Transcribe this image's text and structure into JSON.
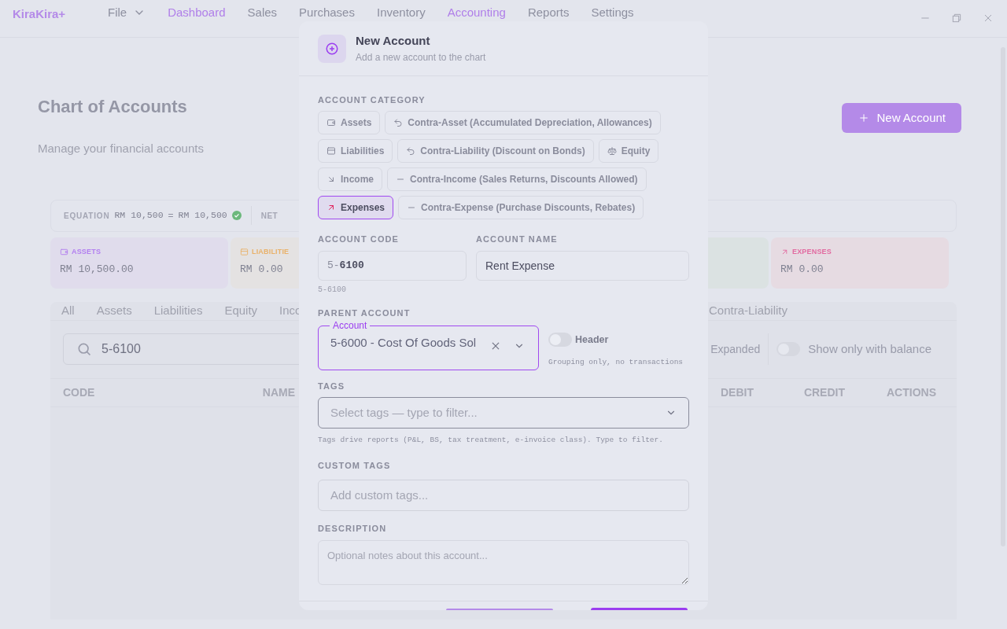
{
  "app": {
    "logo": "KiraKira+"
  },
  "menu": [
    {
      "label": "File",
      "kind": "dropdown",
      "selected": false
    },
    {
      "label": "Dashboard",
      "kind": "link",
      "selected": true
    },
    {
      "label": "Sales",
      "kind": "link",
      "selected": false
    },
    {
      "label": "Purchases",
      "kind": "link",
      "selected": false
    },
    {
      "label": "Inventory",
      "kind": "link",
      "selected": false
    },
    {
      "label": "Accounting",
      "kind": "link",
      "selected": true
    },
    {
      "label": "Reports",
      "kind": "link",
      "selected": false
    },
    {
      "label": "Settings",
      "kind": "link",
      "selected": false
    }
  ],
  "page": {
    "title": "Chart of Accounts",
    "subtitle": "Manage your financial accounts",
    "new_button": "New Account"
  },
  "equation": {
    "label": "EQUATION",
    "left": "RM 10,500",
    "sign": "=",
    "right": "RM 10,500",
    "balanced": true,
    "next_label": "NET"
  },
  "summary_cards": [
    {
      "kind": "assets",
      "label": "ASSETS",
      "amount": "RM 10,500.00"
    },
    {
      "kind": "liabilities",
      "label": "LIABILITIE",
      "amount": "RM 0.00"
    },
    {
      "kind": "income"
    },
    {
      "kind": "expenses",
      "label": "EXPENSES",
      "amount": "RM 0.00"
    }
  ],
  "filter_tabs": [
    {
      "label": "All"
    },
    {
      "label": "Assets"
    },
    {
      "label": "Liabilities"
    },
    {
      "label": "Equity"
    },
    {
      "label": "Inco"
    },
    {
      "label": "Contra-Liability"
    }
  ],
  "search": {
    "value": "5-6100"
  },
  "toggles": [
    {
      "label": "Expanded"
    },
    {
      "label": "Show only with balance",
      "on": false
    }
  ],
  "table": {
    "columns": [
      "CODE",
      "NAME",
      "DEBIT",
      "CREDIT",
      "ACTIONS"
    ]
  },
  "dialog": {
    "title": "New Account",
    "subtitle": "Add a new account to the chart",
    "category_label": "ACCOUNT CATEGORY",
    "categories": [
      {
        "label": "Assets",
        "kind": "asset",
        "selected": false
      },
      {
        "label": "Contra-Asset (Accumulated Depreciation, Allowances)",
        "kind": "contra",
        "selected": false
      },
      {
        "label": "Liabilities",
        "kind": "liability",
        "selected": false
      },
      {
        "label": "Contra-Liability (Discount on Bonds)",
        "kind": "contra",
        "selected": false
      },
      {
        "label": "Equity",
        "kind": "equity",
        "selected": false
      },
      {
        "label": "Income",
        "kind": "income",
        "selected": false
      },
      {
        "label": "Contra-Income (Sales Returns, Discounts Allowed)",
        "kind": "contra-flow",
        "selected": false
      },
      {
        "label": "Expenses",
        "kind": "expense",
        "selected": true
      },
      {
        "label": "Contra-Expense (Purchase Discounts, Rebates)",
        "kind": "contra-flow",
        "selected": false
      }
    ],
    "code": {
      "label": "ACCOUNT CODE",
      "prefix": "5-",
      "value": "6100",
      "hint": "5-6100"
    },
    "name": {
      "label": "ACCOUNT NAME",
      "value": "Rent Expense"
    },
    "parent": {
      "label": "PARENT ACCOUNT",
      "floating_label": "Account",
      "value": "5-6000 - Cost Of Goods Sol"
    },
    "header_toggle": {
      "label": "Header",
      "on": false,
      "hint": "Grouping only, no transactions"
    },
    "tags": {
      "label": "TAGS",
      "placeholder": "Select tags — type to filter...",
      "hint": "Tags drive reports (P&L, BS, tax treatment, e-invoice class). Type to filter."
    },
    "custom_tags": {
      "label": "CUSTOM TAGS",
      "placeholder": "Add custom tags..."
    },
    "description": {
      "label": "DESCRIPTION",
      "placeholder": "Optional notes about this account..."
    }
  }
}
